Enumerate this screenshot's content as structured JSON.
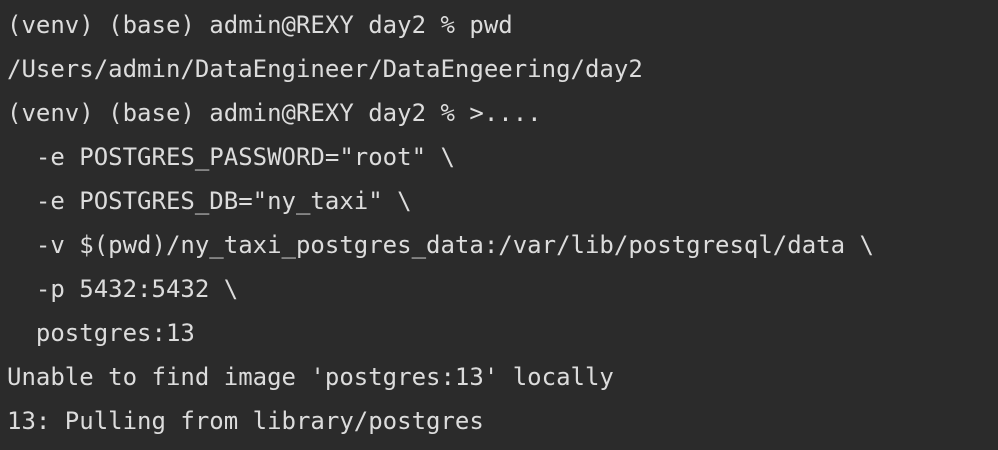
{
  "terminal": {
    "lines": [
      "(venv) (base) admin@REXY day2 % pwd",
      "/Users/admin/DataEngineer/DataEngeering/day2",
      "(venv) (base) admin@REXY day2 % >....",
      "  -e POSTGRES_PASSWORD=\"root\" \\",
      "  -e POSTGRES_DB=\"ny_taxi\" \\",
      "  -v $(pwd)/ny_taxi_postgres_data:/var/lib/postgresql/data \\",
      "  -p 5432:5432 \\",
      "  postgres:13",
      "Unable to find image 'postgres:13' locally",
      "13: Pulling from library/postgres"
    ]
  },
  "colors": {
    "background": "#2b2b2b",
    "text": "#dcdcdc"
  }
}
